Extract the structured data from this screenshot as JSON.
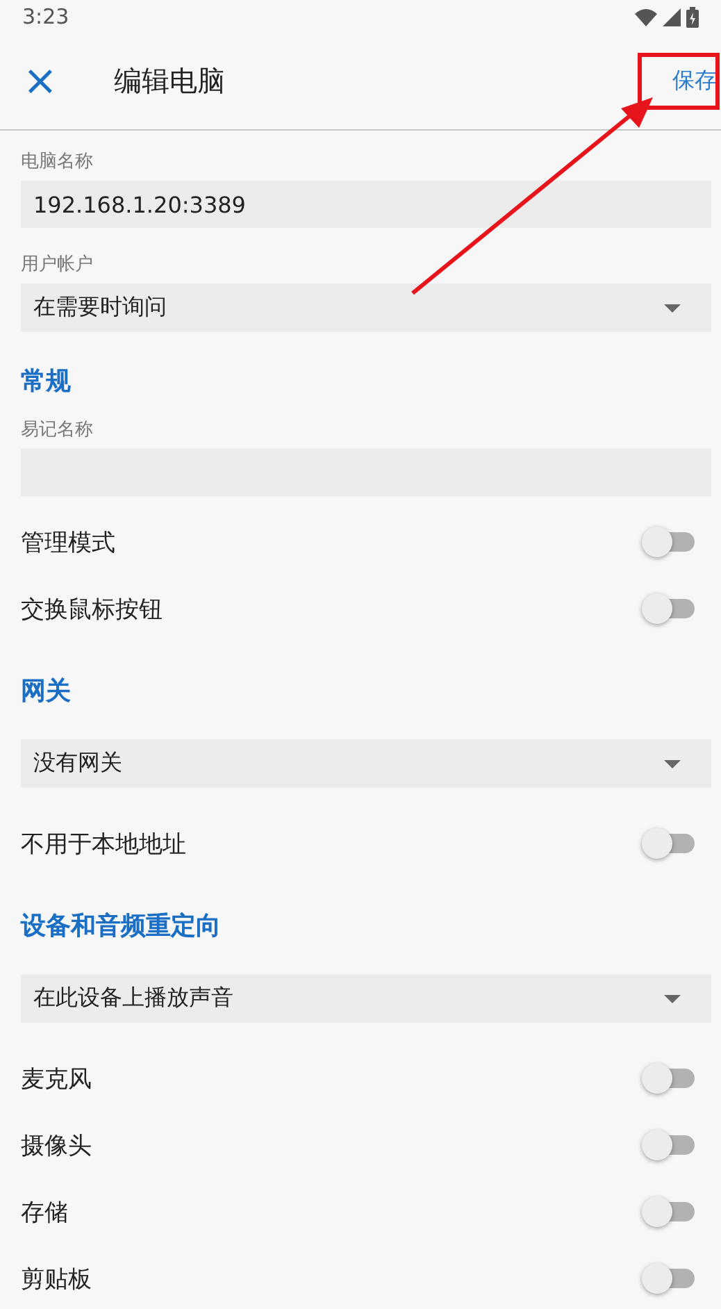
{
  "status_bar": {
    "time": "3:23"
  },
  "toolbar": {
    "close": "×",
    "title": "编辑电脑",
    "action": "保存"
  },
  "items": [
    {
      "kind": "field",
      "label": "电脑名称",
      "value": "192.168.1.20:3389"
    },
    {
      "kind": "dropdown",
      "label": "用户帐户",
      "value": "在需要时询问"
    },
    {
      "kind": "header",
      "label": "常规"
    },
    {
      "kind": "field",
      "label": "易记名称"
    },
    {
      "kind": "switch",
      "label": "管理模式",
      "on": false
    },
    {
      "kind": "switch",
      "label": "交换鼠标按钮",
      "on": false
    },
    {
      "kind": "header",
      "label": "网关"
    },
    {
      "kind": "dropdown",
      "value": "没有网关"
    },
    {
      "kind": "switch",
      "label": "不用于本地地址",
      "on": false
    },
    {
      "kind": "header",
      "label": "设备和音频重定向"
    },
    {
      "kind": "dropdown",
      "value": "在此设备上播放声音"
    },
    {
      "kind": "switch",
      "label": "麦克风",
      "on": false
    },
    {
      "kind": "switch",
      "label": "摄像头",
      "on": false
    },
    {
      "kind": "switch",
      "label": "存储",
      "on": false
    },
    {
      "kind": "switch",
      "label": "剪贴板",
      "on": false
    }
  ]
}
